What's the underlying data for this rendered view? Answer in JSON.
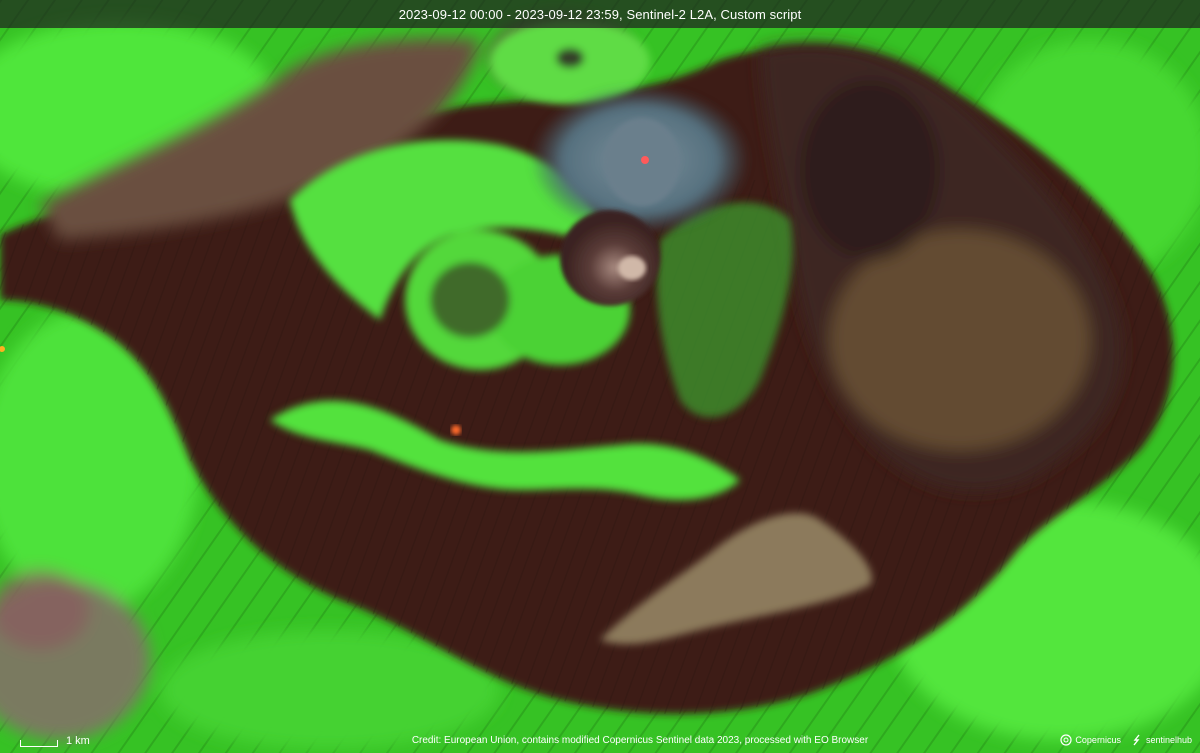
{
  "header": {
    "title": "2023-09-12 00:00 - 2023-09-12 23:59, Sentinel-2 L2A, Custom script"
  },
  "scale": {
    "label": "1 km"
  },
  "footer": {
    "credit": "Credit: European Union, contains modified Copernicus Sentinel data 2023, processed with EO Browser"
  },
  "logos": {
    "copernicus": "Copernicus",
    "sentinelhub": "sentinelhub"
  },
  "colors": {
    "vegetation": "#3fd62a",
    "lava_dark": "#3a1d18",
    "crater_blue": "#5a7080",
    "hotspot": "#ff5a3a"
  }
}
